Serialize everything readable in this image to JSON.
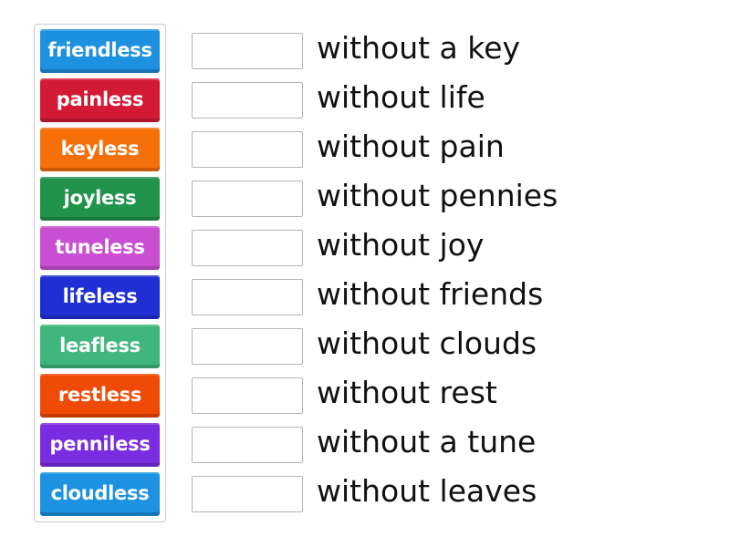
{
  "tiles": [
    {
      "label": "friendless",
      "color": "#1e90e0"
    },
    {
      "label": "painless",
      "color": "#d21a35"
    },
    {
      "label": "keyless",
      "color": "#f6700a"
    },
    {
      "label": "joyless",
      "color": "#21934a"
    },
    {
      "label": "tuneless",
      "color": "#c94fd2"
    },
    {
      "label": "lifeless",
      "color": "#1f2fd3"
    },
    {
      "label": "leafless",
      "color": "#3fb77c"
    },
    {
      "label": "restless",
      "color": "#f04a07"
    },
    {
      "label": "penniless",
      "color": "#7a2ce0"
    },
    {
      "label": "cloudless",
      "color": "#1c92e0"
    }
  ],
  "definitions": [
    "without a key",
    "without life",
    "without pain",
    "without pennies",
    "without joy",
    "without friends",
    "without clouds",
    "without rest",
    "without a tune",
    "without leaves"
  ]
}
